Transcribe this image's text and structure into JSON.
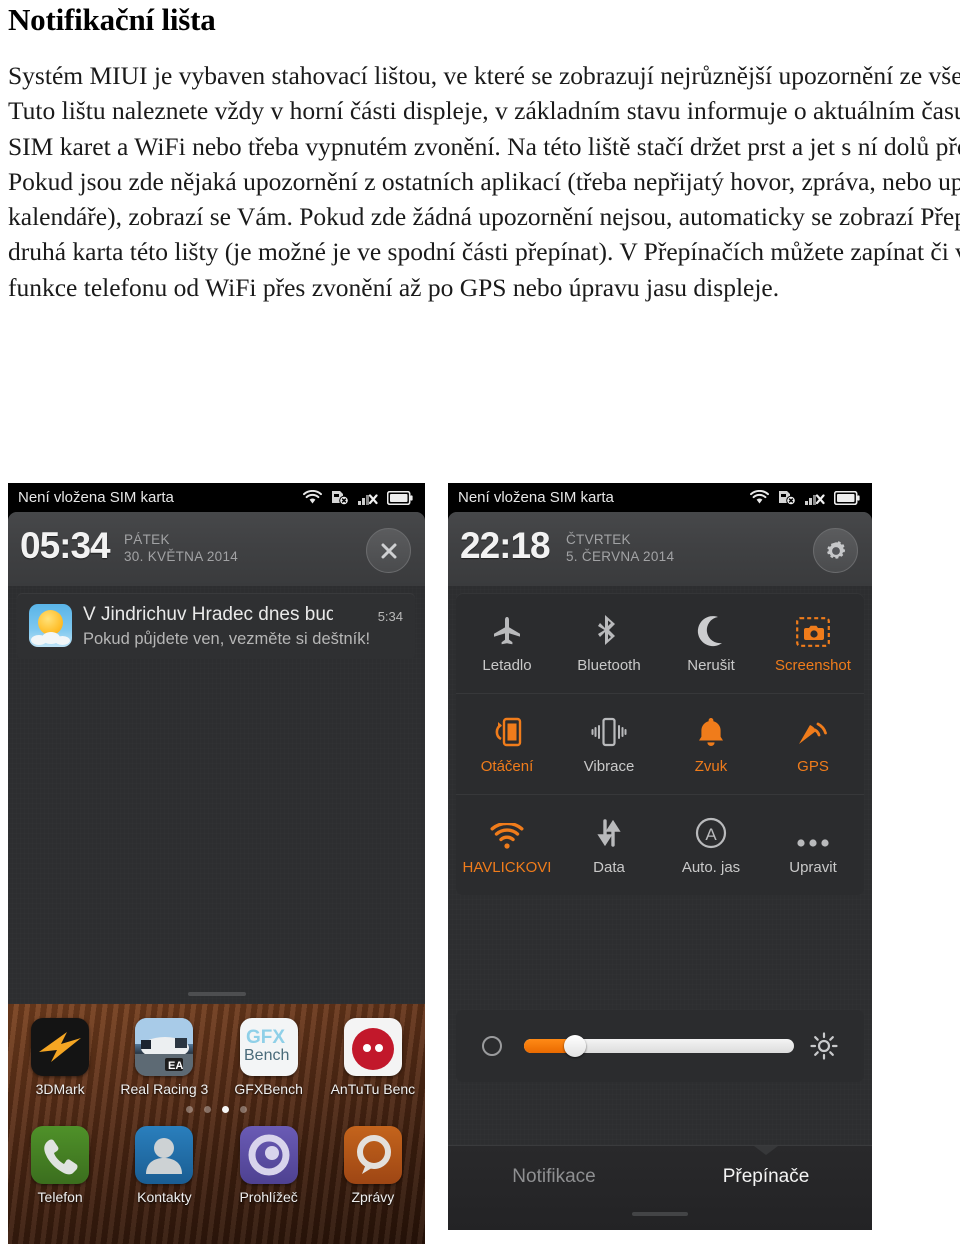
{
  "document": {
    "title": "Notifikační lišta",
    "body": "Systém MIUI je vybaven stahovací lištou, ve které se zobrazují nejrůznější upozornění ze všech aplikací. Tuto lištu naleznete vždy v horní části displeje, v základním stavu informuje o aktuálním času, stavu signálu SIM karet a WiFi nebo třeba vypnutém zvonění. Na této liště stačí držet prst a jet s ní dolů přes celý displej. Pokud jsou zde nějaká upozornění z ostatních aplikací (třeba nepřijatý hovor, zpráva, nebo upomínka z kalendáře), zobrazí se Vám. Pokud zde žádná upozornění nejsou, automaticky se zobrazí Přepínače, což je druhá karta této lišty (je možné je ve spodní části přepínat). V Přepínačích můžete zapínat či vypínat různé funkce telefonu od WiFi přes zvonění až po GPS nebo úpravu jasu displeje."
  },
  "colors": {
    "accent_orange": "#f07c1b",
    "panel_bg": "#2b2c2e",
    "status_bar_bg": "#000000",
    "label_grey": "#c9c9c9"
  },
  "screenshot_left": {
    "status_bar": {
      "text": "Není vložena SIM karta",
      "icons": [
        "wifi-icon",
        "sim-card-error-icon",
        "signal-no-service-icon",
        "battery-icon"
      ]
    },
    "header": {
      "clock": "05:34",
      "weekday": "PÁTEK",
      "date": "30. KVĚTNA 2014",
      "button": "close-icon"
    },
    "notification": {
      "icon": "weather-sun-icon",
      "title": "V Jindrichuv Hradec dnes bud",
      "subtitle": "Pokud půjdete ven, vezměte si deštník!",
      "time": "5:34"
    },
    "homescreen": {
      "apps": [
        {
          "label": "3DMark",
          "icon": "3dmark-icon"
        },
        {
          "label": "Real Racing 3",
          "icon": "real-racing-icon"
        },
        {
          "label": "GFXBench",
          "icon": "gfxbench-icon"
        },
        {
          "label": "AnTuTu Benc",
          "icon": "antutu-icon"
        }
      ],
      "page_dots": 4,
      "active_dot": 3,
      "dock": [
        {
          "label": "Telefon",
          "icon": "phone-icon",
          "color": "#3f7a22"
        },
        {
          "label": "Kontakty",
          "icon": "contacts-icon",
          "color": "#1f6ea8"
        },
        {
          "label": "Prohlížeč",
          "icon": "browser-icon",
          "color": "#5a4a9e"
        },
        {
          "label": "Zprávy",
          "icon": "messages-icon",
          "color": "#b0531a"
        }
      ]
    }
  },
  "screenshot_right": {
    "status_bar": {
      "text": "Není vložena SIM karta",
      "icons": [
        "wifi-icon",
        "sim-card-error-icon",
        "signal-no-service-icon",
        "battery-icon"
      ]
    },
    "header": {
      "clock": "22:18",
      "weekday": "ČTVRTEK",
      "date": "5. ČERVNA 2014",
      "button": "gear-icon"
    },
    "toggles": [
      [
        {
          "label": "Letadlo",
          "icon": "airplane-icon",
          "active": false
        },
        {
          "label": "Bluetooth",
          "icon": "bluetooth-icon",
          "active": false
        },
        {
          "label": "Nerušit",
          "icon": "moon-icon",
          "active": false
        },
        {
          "label": "Screenshot",
          "icon": "screenshot-icon",
          "active": true
        }
      ],
      [
        {
          "label": "Otáčení",
          "icon": "rotation-icon",
          "active": true
        },
        {
          "label": "Vibrace",
          "icon": "vibrate-icon",
          "active": false
        },
        {
          "label": "Zvuk",
          "icon": "bell-icon",
          "active": true
        },
        {
          "label": "GPS",
          "icon": "gps-icon",
          "active": true
        }
      ],
      [
        {
          "label": "HAVLICKOVI",
          "icon": "wifi-icon",
          "active": true
        },
        {
          "label": "Data",
          "icon": "data-sync-icon",
          "active": false
        },
        {
          "label": "Auto. jas",
          "icon": "auto-brightness-icon",
          "active": false
        },
        {
          "label": "Upravit",
          "icon": "more-dots-icon",
          "active": false
        }
      ]
    ],
    "brightness": {
      "left_icon": "brightness-low-icon",
      "right_icon": "brightness-high-icon",
      "value_percent": 19
    },
    "tabs": [
      {
        "label": "Notifikace",
        "active": false
      },
      {
        "label": "Přepínače",
        "active": true
      }
    ]
  }
}
